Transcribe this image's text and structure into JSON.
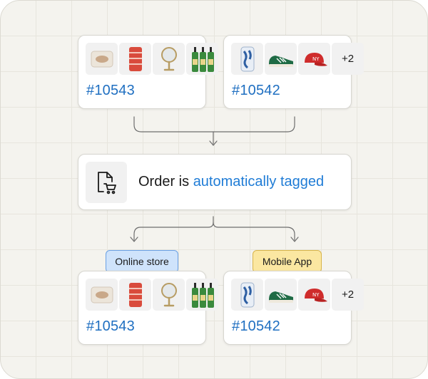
{
  "top_orders": [
    {
      "id": "#10543",
      "items": [
        "pillow-icon",
        "red-towel-icon",
        "mirror-icon",
        "bottles-icon"
      ],
      "more": ""
    },
    {
      "id": "#10542",
      "items": [
        "blue-phone-case-icon",
        "green-sneaker-icon",
        "red-cap-icon"
      ],
      "more": "+2"
    }
  ],
  "process": {
    "prefix": "Order is ",
    "accent": "automatically tagged",
    "icon": "cart-document-icon"
  },
  "tags": {
    "online": "Online store",
    "mobile": "Mobile App"
  },
  "bottom_orders": [
    {
      "id": "#10543",
      "items": [
        "pillow-icon",
        "red-towel-icon",
        "mirror-icon",
        "bottles-icon"
      ],
      "more": ""
    },
    {
      "id": "#10542",
      "items": [
        "blue-phone-case-icon",
        "green-sneaker-icon",
        "red-cap-icon"
      ],
      "more": "+2"
    }
  ],
  "colors": {
    "order_id": "#1f6fc1",
    "accent": "#1f7cd6",
    "online_tag_bg": "#cfe3fb",
    "mobile_tag_bg": "#fbe7a1"
  }
}
